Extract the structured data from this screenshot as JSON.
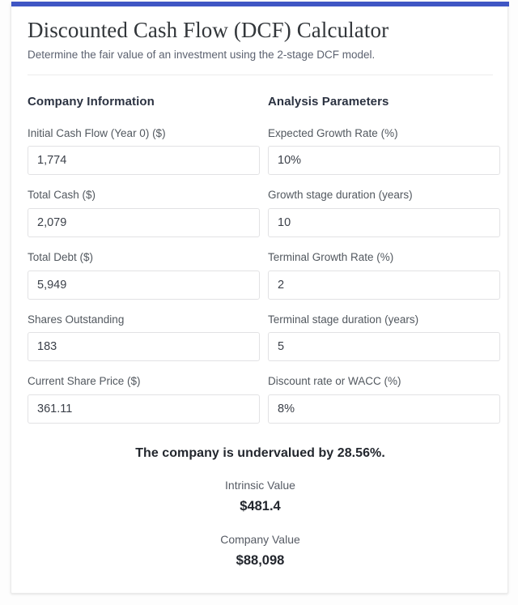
{
  "theme": {
    "accent": "#3f56c4",
    "card_bg": "#ffffff",
    "page_bg": "#fdfdfd",
    "label_color": "#52585f",
    "heading_color": "#2b3241",
    "input_border": "#e2e2e4"
  },
  "header": {
    "title": "Discounted Cash Flow (DCF) Calculator",
    "subtitle": "Determine the fair value of an investment using the 2-stage DCF model."
  },
  "company_information": {
    "heading": "Company Information",
    "fields": [
      {
        "label": "Initial Cash Flow (Year 0) ($)",
        "value": "1,774"
      },
      {
        "label": "Total Cash ($)",
        "value": "2,079"
      },
      {
        "label": "Total Debt ($)",
        "value": "5,949"
      },
      {
        "label": "Shares Outstanding",
        "value": "183"
      },
      {
        "label": "Current Share Price ($)",
        "value": "361.11"
      }
    ]
  },
  "analysis_parameters": {
    "heading": "Analysis Parameters",
    "fields": [
      {
        "label": "Expected Growth Rate (%)",
        "value": "10%"
      },
      {
        "label": "Growth stage duration (years)",
        "value": "10"
      },
      {
        "label": "Terminal Growth Rate (%)",
        "value": "2"
      },
      {
        "label": "Terminal stage duration (years)",
        "value": "5"
      },
      {
        "label": "Discount rate or WACC (%)",
        "value": "8%"
      }
    ]
  },
  "results": {
    "verdict": "The company is undervalued by 28.56%.",
    "intrinsic_value_label": "Intrinsic Value",
    "intrinsic_value": "$481.4",
    "company_value_label": "Company Value",
    "company_value": "$88,098"
  }
}
